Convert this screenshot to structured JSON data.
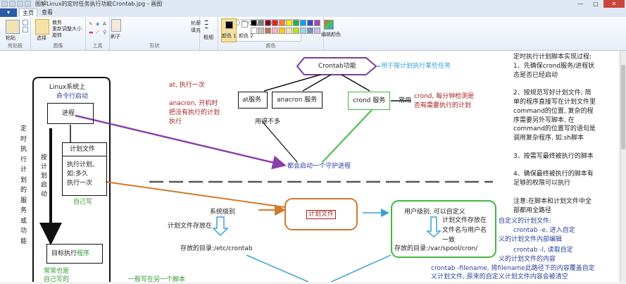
{
  "window": {
    "title": "图解Linux的定时任务执行功能Crontab.jpg - 画图",
    "buttons": {
      "minimize": "—",
      "maximize": "□",
      "close": "✕"
    }
  },
  "tabs": {
    "file": "",
    "home": "主页",
    "view": "查看"
  },
  "ribbon": {
    "clipboard": {
      "paste": "粘贴",
      "label": "剪贴板"
    },
    "image": {
      "select": "选择",
      "crop": "裁剪",
      "resize": "重新调整大小",
      "rotate": "旋转",
      "label": "图像"
    },
    "tools": {
      "label": "工具"
    },
    "brushes": {
      "label": "刷子"
    },
    "shapes": {
      "outline": "轮廓",
      "fill": "填充",
      "label": "形状",
      "glyphs": "╱○□◇△▷☆⬡▭⬠→←↑↓✦✧✩"
    },
    "size": {
      "label": "粗细"
    },
    "color1": {
      "label": "颜色 1"
    },
    "color2": {
      "label": "颜色 2"
    },
    "edit_colors": {
      "label": "编辑颜色"
    },
    "colors": {
      "label": "颜色"
    },
    "palette": [
      "#000000",
      "#7f7f7f",
      "#880015",
      "#ed1c24",
      "#ff7f27",
      "#fff200",
      "#22b14c",
      "#00a2e8",
      "#3f48cc",
      "#a349a4",
      "#ffffff",
      "#c3c3c3",
      "#b97a57",
      "#ffaec9",
      "#ffc90e",
      "#efe4b0",
      "#b5e61d",
      "#99d9ea",
      "#7092be",
      "#c8bfe7"
    ]
  },
  "diagram": {
    "linux_system": "Linux系统上",
    "command_start": "命令行启动",
    "process": "进程",
    "plan_file_box": "计划文件",
    "plan_file_text": [
      "执行计划,",
      "如:多久",
      "执行一次"
    ],
    "write_self": "自己写",
    "target_exec": "目标执行",
    "program": "程序",
    "common_write": [
      "常常也是",
      "自己写的"
    ],
    "vertical_left": [
      "定",
      "时",
      "执",
      "行",
      "计",
      "划",
      "的",
      "服",
      "务",
      "或",
      "功",
      "能"
    ],
    "by_plan_start": [
      "按",
      "计",
      "划",
      "启",
      "动"
    ],
    "crontab_func": "Crontab功能",
    "for_plan_tasks": "用于按计划执行某些任务",
    "at_exec_once": "at, 执行一次",
    "anacron_desc": [
      "anacron, 开机时",
      "把没有执行的计划",
      "执行"
    ],
    "at_service": "at服务",
    "anacron_service": "anacron 服务",
    "crond_service": "crond 服务",
    "common_use": "常用",
    "crond_desc": [
      "crond, 每分钟检测是",
      "否有需要执行的计划"
    ],
    "rarely_used": "用得不多",
    "daemon_start": "都会启动一个守护进程",
    "plan_file_center": "计划文件",
    "system_level": "系统级别",
    "plan_file_stored_in": "计划文件存放在",
    "stored_dir_etc": "存放的目录:/etc/crontab",
    "user_level": "用户级别, 可以自定义",
    "user_file_store": [
      "计划文件存放在",
      "文件名与用户名",
      "一致"
    ],
    "stored_dir_var": "存放的目录:/var/spool/cron/",
    "general_script": "一般写在另一个脚本",
    "right_notes": [
      "定时执行计划脚本实现过程:",
      "1、先确保crond服务/进程状",
      "态是否已经启动",
      "",
      "2、按规范写好计划文件, 简",
      "单的程序直接写在计划文件里",
      "command的位置, 复杂的程",
      "序需要另外写脚本, 在",
      "command的位置写的语句是",
      "调用复杂程序, 如.sh脚本",
      "",
      "3、按需写最终被执行的脚本",
      "",
      "4、确保最终被执行的脚本有",
      "足够的权限可以执行",
      "",
      "注意:在脚本和计划文件中全",
      "部都用全路径"
    ],
    "custom_notes": [
      "自定义的计划文件:",
      "crontab -e, 进入自定",
      "义的计划文件内部编辑",
      "crontab -l, 读取自定",
      "义的计划文件的内容",
      "crontab -filename, 将filename此路径下的内容覆盖自定",
      "义计划文件, 原来的自定义计划文件内容会被清空"
    ]
  }
}
